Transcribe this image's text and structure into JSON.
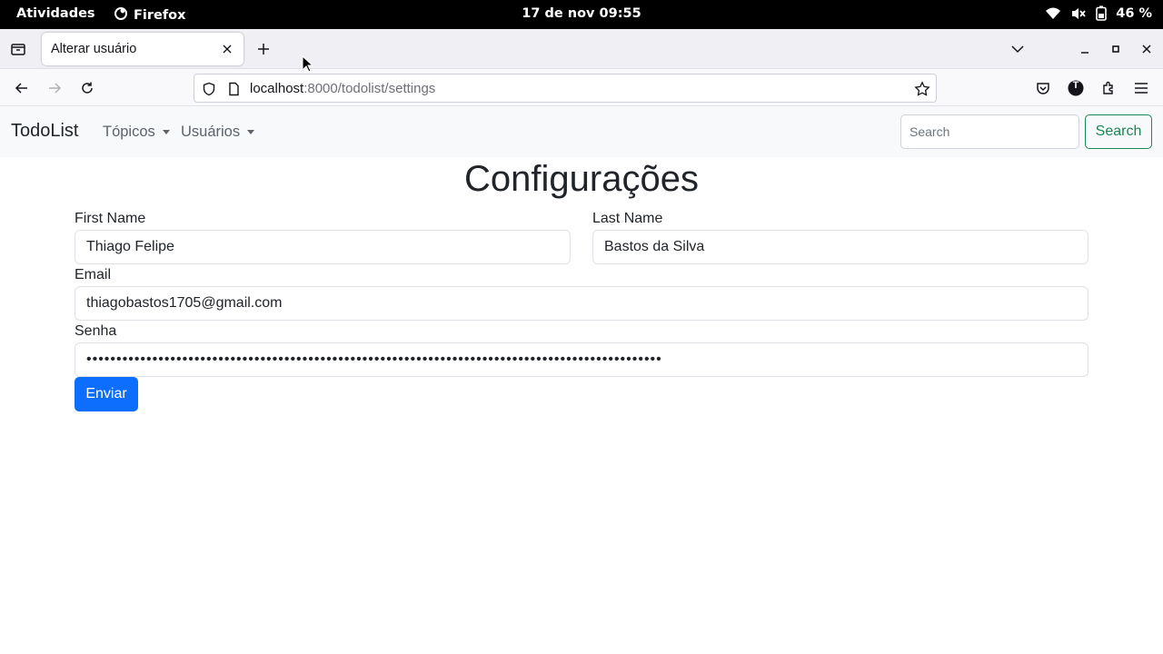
{
  "system_bar": {
    "activities": "Atividades",
    "app_name": "Firefox",
    "clock": "17 de nov  09:55",
    "battery": "46 %",
    "icons": [
      "firefox-icon",
      "wifi-icon",
      "volume-muted-icon",
      "battery-icon"
    ]
  },
  "browser": {
    "tab_title": "Alterar usuário",
    "url_host": "localhost",
    "url_path": ":8000/todolist/settings",
    "icons": [
      "tab-list-icon",
      "new-tab-icon",
      "all-tabs-icon",
      "minimize-icon",
      "maximize-icon",
      "close-window-icon",
      "back-icon",
      "forward-icon",
      "reload-icon",
      "shield-icon",
      "page-info-icon",
      "bookmark-star-icon",
      "pocket-icon",
      "account-icon",
      "extensions-icon",
      "menu-icon"
    ],
    "account_initial": "T"
  },
  "site_nav": {
    "brand": "TodoList",
    "items": [
      {
        "label": "Tópicos"
      },
      {
        "label": "Usuários"
      }
    ],
    "search_placeholder": "Search",
    "search_button": "Search"
  },
  "form": {
    "title": "Configurações",
    "first_name_label": "First Name",
    "first_name_value": "Thiago Felipe",
    "last_name_label": "Last Name",
    "last_name_value": "Bastos da Silva",
    "email_label": "Email",
    "email_value": "thiagobastos1705@gmail.com",
    "password_label": "Senha",
    "password_value": "••••••••••••••••••••••••••••••••••••••••••••••••••••••••••••••••••••••••••••••••••••••••••••••••",
    "submit_label": "Enviar"
  },
  "colors": {
    "primary": "#0d6efd",
    "success": "#198754",
    "navbar_bg": "#f8f9fa",
    "system_bar_bg": "#000000"
  }
}
